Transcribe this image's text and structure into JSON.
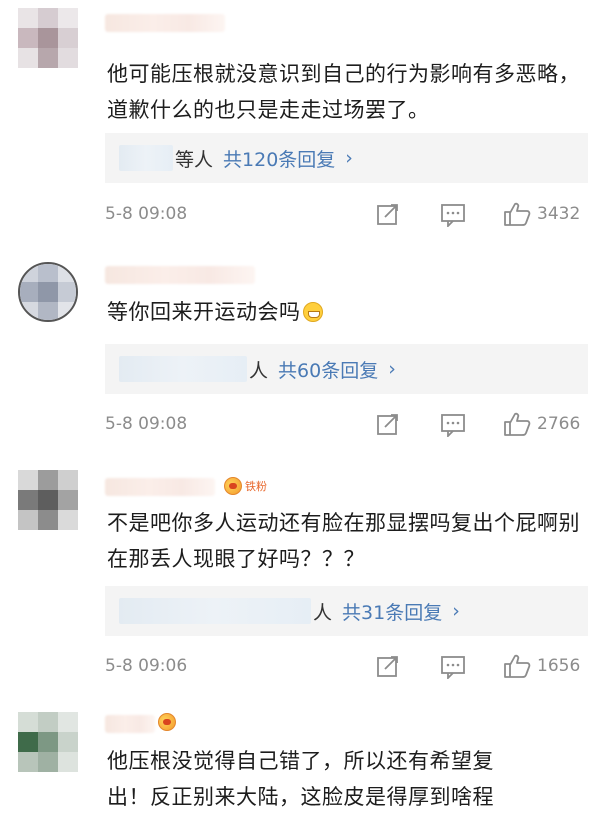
{
  "comments": [
    {
      "text": "他可能压根就没意识到自己的行为影响有多恶略，道歉什么的也只是走走过场罢了。",
      "reply_suffix": "等人",
      "reply_count": "共120条回复",
      "reply_chevron": "›",
      "timestamp": "5-8 09:08",
      "likes": "3432"
    },
    {
      "text": "等你回来开运动会吗",
      "reply_suffix": "人",
      "reply_count": "共60条回复",
      "reply_chevron": "›",
      "timestamp": "5-8 09:08",
      "likes": "2766"
    },
    {
      "badge": "铁粉",
      "text": "不是吧你多人运动还有脸在那显摆吗复出个屁啊别在那丢人现眼了好吗？？？",
      "reply_suffix": "人",
      "reply_count": "共31条回复",
      "reply_chevron": "›",
      "timestamp": "5-8 09:06",
      "likes": "1656"
    },
    {
      "text_line1": "他压根没觉得自己错了，所以还有希望复",
      "text_line2": "出！反正别来大陆，这脸皮是得厚到啥程"
    }
  ],
  "colors": {
    "link_blue": "#4a7ab5",
    "meta_gray": "#8c8c8c",
    "reply_bg": "#f4f4f4"
  },
  "icons": [
    "share-icon",
    "comment-icon",
    "thumbs-up-icon",
    "fan-badge-icon",
    "grin-emoji-icon"
  ]
}
